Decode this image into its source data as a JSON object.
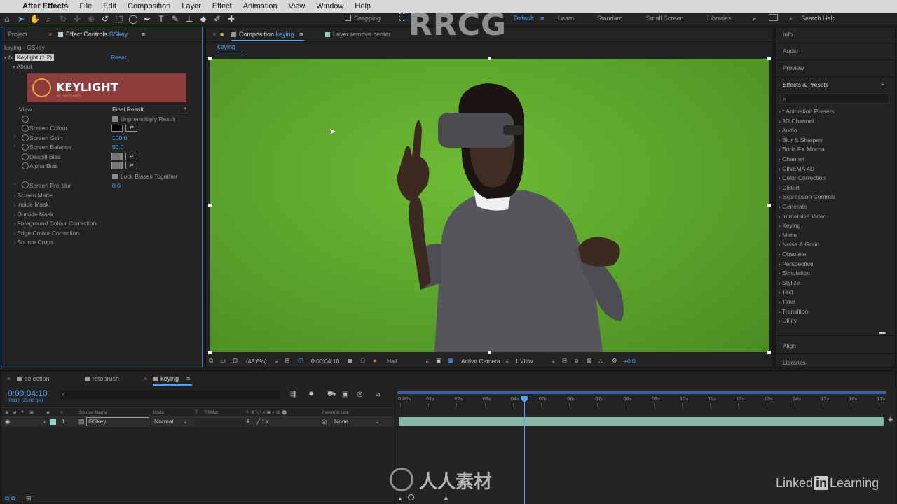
{
  "menu": {
    "app": "After Effects",
    "items": [
      "File",
      "Edit",
      "Composition",
      "Layer",
      "Effect",
      "Animation",
      "View",
      "Window",
      "Help"
    ]
  },
  "toolbar": {
    "snapping": "Snapping",
    "workspaces": [
      "Default",
      "Learn",
      "Standard",
      "Small Screen",
      "Libraries"
    ],
    "search_placeholder": "Search Help"
  },
  "watermark": {
    "rrcg": "RRCG",
    "brand": "人人素材",
    "linkedin": "Linked",
    "linkedin_box": "in",
    "learning": "Learning"
  },
  "left_panel": {
    "tabs": [
      "Project",
      "Effect Controls",
      "GSkey"
    ],
    "layer_path": "keying - GSkey",
    "effect_name": "Keylight (1.2)",
    "reset": "Reset",
    "about": "About",
    "logo": "KEYLIGHT",
    "logo_sub": "BY THE FOUNDRY",
    "props": {
      "view_label": "View",
      "view_value": "Final Result",
      "unpremultiply": "Unpremultiply Result",
      "screen_colour": "Screen Colour",
      "screen_gain": "Screen Gain",
      "screen_gain_value": "100.0",
      "screen_balance": "Screen Balance",
      "screen_balance_value": "50.0",
      "despill_bias": "Despill Bias",
      "alpha_bias": "Alpha Bias",
      "lock_biases": "Lock Biases Together",
      "screen_preblur": "Screen Pre-blur",
      "screen_preblur_value": "0.0",
      "screen_matte": "Screen Matte",
      "inside_mask": "Inside Mask",
      "outside_mask": "Outside Mask",
      "fg_colour_corr": "Foreground Colour Correction",
      "edge_colour_corr": "Edge Colour Correction",
      "source_crops": "Source Crops"
    }
  },
  "comp_panel": {
    "tab_label": "Composition",
    "tab_name": "keying",
    "second_tab": "Layer remove center",
    "breadcrumb": "keying",
    "footer": {
      "zoom": "(48.6%)",
      "timecode": "0:00:04:10",
      "resolution": "Half",
      "camera": "Active Camera",
      "views": "1 View",
      "exposure": "+0.0"
    }
  },
  "right_panel": {
    "items": [
      "Info",
      "Audio",
      "Preview"
    ],
    "effects_title": "Effects & Presets",
    "search_placeholder": "",
    "categories": [
      "* Animation Presets",
      "3D Channel",
      "Audio",
      "Blur & Sharpen",
      "Boris FX Mocha",
      "Channel",
      "CINEMA 4D",
      "Color Correction",
      "Distort",
      "Expression Controls",
      "Generate",
      "Immersive Video",
      "Keying",
      "Matte",
      "Noise & Grain",
      "Obsolete",
      "Perspective",
      "Simulation",
      "Stylize",
      "Text",
      "Time",
      "Transition",
      "Utility"
    ],
    "bottom": [
      "Align",
      "Libraries"
    ]
  },
  "timeline": {
    "tabs": [
      "selection",
      "rotobrush",
      "keying"
    ],
    "timecode": "0:00:04:10",
    "fps": "00110 (25.00 fps)",
    "columns": {
      "num": "#",
      "source": "Source Name",
      "mode": "Mode",
      "t": "T",
      "trkmat": "TrkMat",
      "parent": "Parent & Link"
    },
    "layer": {
      "num": "1",
      "name": "GSkey",
      "mode": "Normal",
      "parent": "None"
    },
    "ruler": [
      "0:00s",
      "01s",
      "02s",
      "03s",
      "04s",
      "05s",
      "06s",
      "07s",
      "08s",
      "09s",
      "10s",
      "11s",
      "12s",
      "13s",
      "14s",
      "15s",
      "16s",
      "17s"
    ],
    "playhead_seconds": 4.4
  },
  "colors": {
    "accent": "#4fa4ff",
    "green_screen": "#5da62c",
    "track": "#86b7a8",
    "panel": "#232323",
    "keylight_logo": "#8e3d3d"
  }
}
